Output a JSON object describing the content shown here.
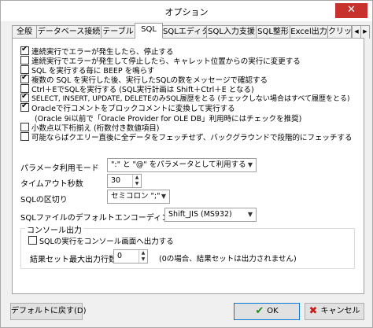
{
  "window": {
    "title": "オプション",
    "close_glyph": "✕"
  },
  "tabs": [
    {
      "label": "全般"
    },
    {
      "label": "データベース接続"
    },
    {
      "label": "テーブル"
    },
    {
      "label": "SQL",
      "active": true
    },
    {
      "label": "SQLエディタ"
    },
    {
      "label": "SQL入力支援"
    },
    {
      "label": "SQL整形"
    },
    {
      "label": "Excel出力"
    },
    {
      "label": "クリップ"
    }
  ],
  "tab_scroll": {
    "left_glyph": "◀",
    "right_glyph": "▶"
  },
  "checkboxes": [
    {
      "label": "連続実行でエラーが発生したら、停止する",
      "checked": true
    },
    {
      "label": "連続実行でエラーが発生して停止したら、キャレット位置からの実行に変更する",
      "checked": false
    },
    {
      "label": "SQL を実行する毎に BEEP を鳴らす",
      "checked": false
    },
    {
      "label": "複数の SQL を実行した後、実行したSQLの数をメッセージで確認する",
      "checked": true
    },
    {
      "label": "Ctrl＋EでSQLを実行する (SQL実行計画は Shift＋Ctrl＋E となる)",
      "checked": false
    },
    {
      "label": "SELECT, INSERT, UPDATE, DELETEのみSQL履歴をとる (チェックしない場合はすべて履歴をとる)",
      "checked": true
    },
    {
      "label": "Oracleで行コメントをブロックコメントに変換して実行する",
      "checked": true
    }
  ],
  "oracle_note": "(Oracle 9i以前で「Oracle Provider for OLE DB」利用時にはチェックを推奨)",
  "checkboxes2": [
    {
      "label": "小数点以下桁揃え (桁数付き数値項目)",
      "checked": false
    },
    {
      "label": "可能ならばクエリー直後に全データをフェッチせず、バックグラウンドで段階的にフェッチする",
      "checked": false
    }
  ],
  "fields": {
    "param_mode_label": "パラメータ利用モード",
    "param_mode_value": "\":\" と \"@\" をパラメータとして利用する",
    "timeout_label": "タイムアウト秒数",
    "timeout_value": "30",
    "delimiter_label": "SQLの区切り",
    "delimiter_value": "セミコロン \";\"",
    "encoding_label": "SQLファイルのデフォルトエンコーディング",
    "encoding_value": "Shift_JIS (MS932)"
  },
  "console": {
    "group_title": "コンソール出力",
    "output_label": "SQLの実行をコンソール画面へ出力する",
    "output_checked": false,
    "max_rows_label": "結果セット最大出力行数",
    "max_rows_value": "0",
    "max_rows_note": "(0の場合、結果セットは出力されません)"
  },
  "buttons": {
    "default_label": "デフォルトに戻す(D)",
    "ok_label": "OK",
    "cancel_label": "キャンセル",
    "ok_glyph": "✔",
    "cancel_glyph": "✖"
  },
  "glyphs": {
    "dropdown": "▼",
    "spin_up": "▲",
    "spin_down": "▼"
  }
}
